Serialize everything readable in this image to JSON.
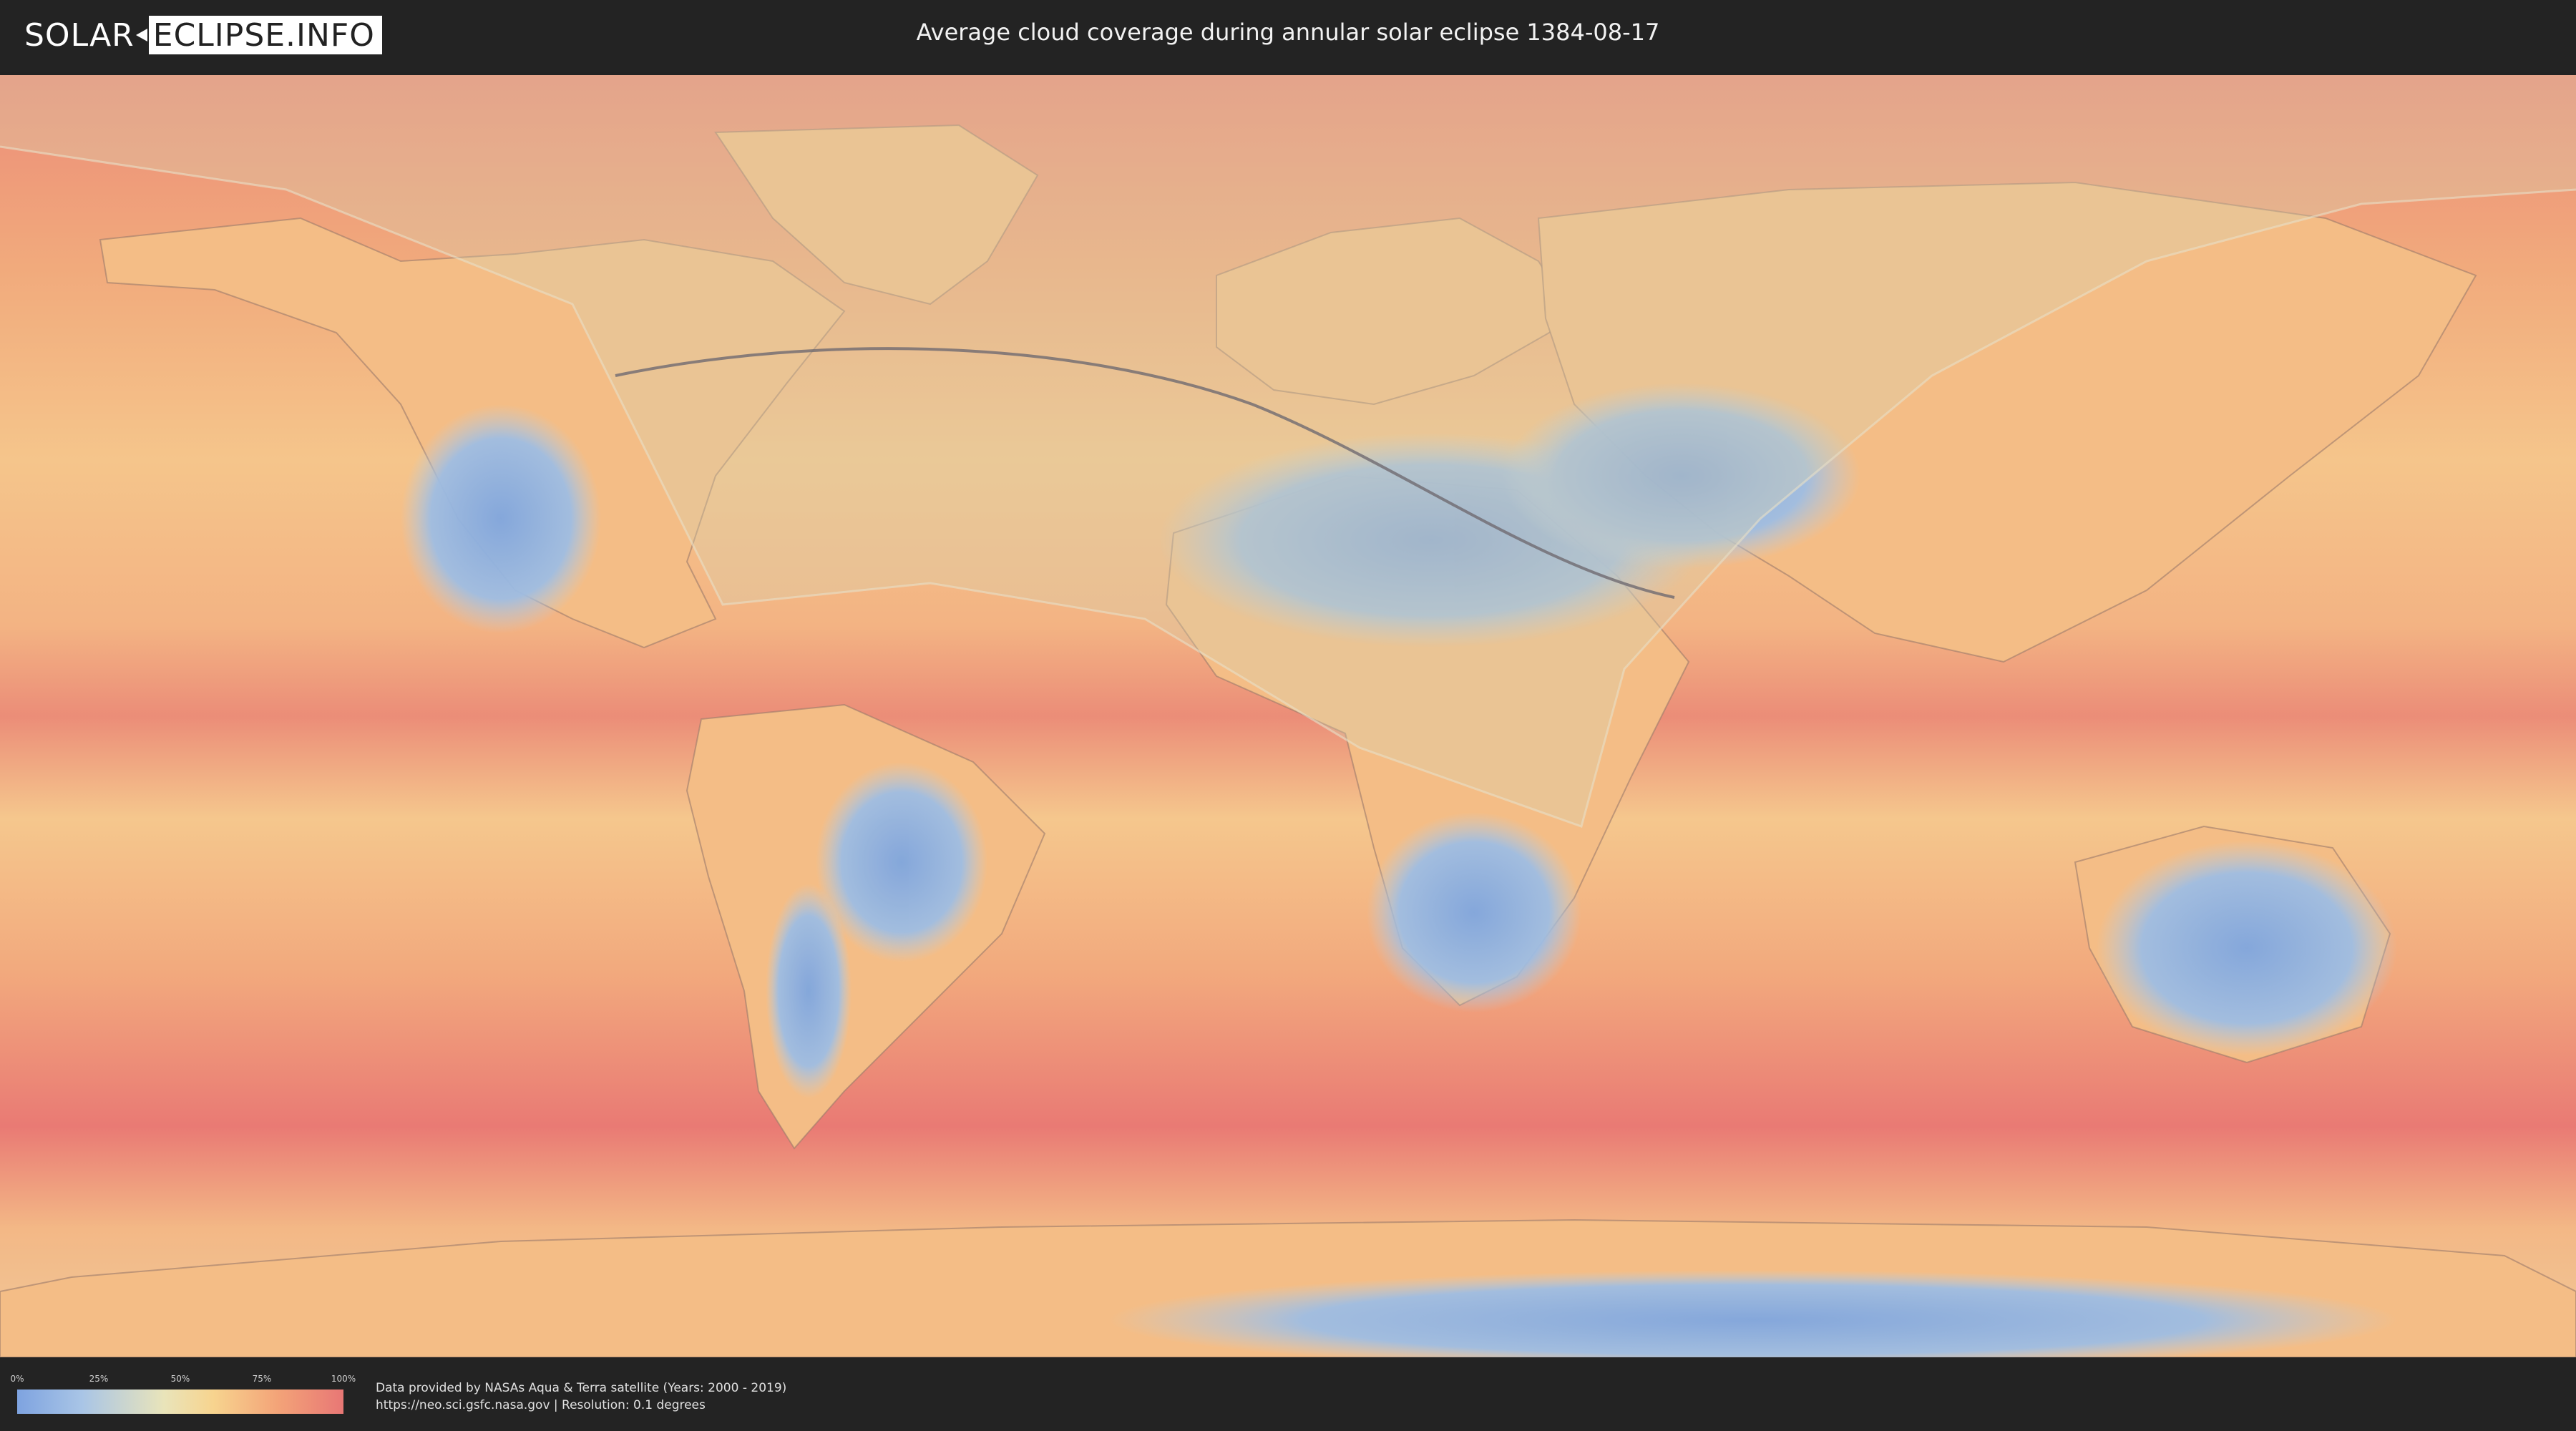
{
  "header": {
    "logo_left": "SOLAR",
    "logo_right": "ECLIPSE.INFO",
    "title": "Average cloud coverage during annular solar eclipse 1384-08-17"
  },
  "legend": {
    "ticks": [
      "0%",
      "25%",
      "50%",
      "75%",
      "100%"
    ],
    "colors": [
      "#7ea3e0",
      "#e9e4ba",
      "#f7d48f",
      "#f3a378",
      "#e87775"
    ]
  },
  "footer": {
    "credit_line1": "Data provided by NASAs Aqua & Terra satellite (Years: 2000 - 2019)",
    "credit_line2": "https://neo.sci.gsfc.nasa.gov | Resolution: 0.1 degrees"
  },
  "map": {
    "projection": "equirectangular",
    "ocean_color": "#efa07a",
    "clear_color": "#7fa6df",
    "eclipse_overlay": "visibility zone and central path of annular eclipse"
  }
}
